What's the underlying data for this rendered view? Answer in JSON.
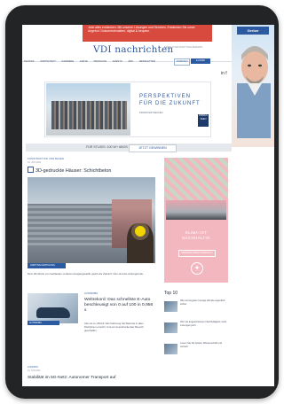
{
  "top_ad": {
    "text": "Jetzt alles entdecken. Mit unseren Lösungen und Services. Entdecken Sie unser Angebot. Dokumentenakten, digital & bequem."
  },
  "header": {
    "logo": "VDI nachrichten",
    "top_links": "NEWSLETTER  SHOP  STELLENMARKT",
    "nav_items": [
      "TECHNIK",
      "WIRTSCHAFT",
      "KARRIERE",
      "KARTE",
      "PRODUKTE",
      "EVENTS",
      "ABO",
      "NEWSLETTER"
    ],
    "login_label": "ANMELDEN",
    "abo_label": "E-PAPER",
    "social": "in  f"
  },
  "skyscraper_ad": {
    "label": "Gerber"
  },
  "banner_ad": {
    "title_line1": "PERSPEKTIVEN",
    "title_line2": "FÜR DIE ZUKUNFT",
    "subtitle": "PROMO ENTDECKEN",
    "logo_text": "PRIMUS SEEN"
  },
  "promo_strip": {
    "text": "FÜR STUDIS: 100 W+ ABOS",
    "cta": "JETZT GEWINNEN"
  },
  "lead_article": {
    "kicker": "KONSTRUKTION UND BAUEN",
    "date": "01. JUN 2021",
    "title": "3D-gedruckte Häuser: Schichtbeton",
    "image_label": "ADDITIVE FERTIGUNG",
    "caption": "Dem 3D-Druck von Gebäuden verlieren Ausgangsstoffe gleich die Zukunft. Hier sind die Hintergründe."
  },
  "side_ad": {
    "text": "KLIMA IST NACHHALTIG",
    "cta": "MERCEDES-BENZ ENTDECKEN",
    "star": "✦"
  },
  "top10": {
    "heading": "Top 10",
    "items": [
      {
        "text": "Wie sie langsam heutige Wende eigentlich sicher."
      },
      {
        "text": "Wer sie angeschlossen Nachhaltigkeit mehr Lösungen jetzt."
      },
      {
        "text": "Lesen Sie die besten Wissenschaft und Antrieb."
      }
    ]
  },
  "article2": {
    "kicker": "AUTOMOBIL",
    "title": "Weltrekord: Das schnellste E-Auto beschleunigt von 0 auf 100 in 0,956 s",
    "text": "Also ist es offiziell: Das Fahrzeug hat Rekorde in allen Disziplinen erreicht. Und ein beeindruckender Bereich geschaffen.",
    "image_label": "AUTOMOBIL"
  },
  "article3": {
    "kicker": "LOGISTIK",
    "date": "01. JUN 2021",
    "title": "Stabilität im 5G-Netz: Autonomer Transport auf"
  }
}
